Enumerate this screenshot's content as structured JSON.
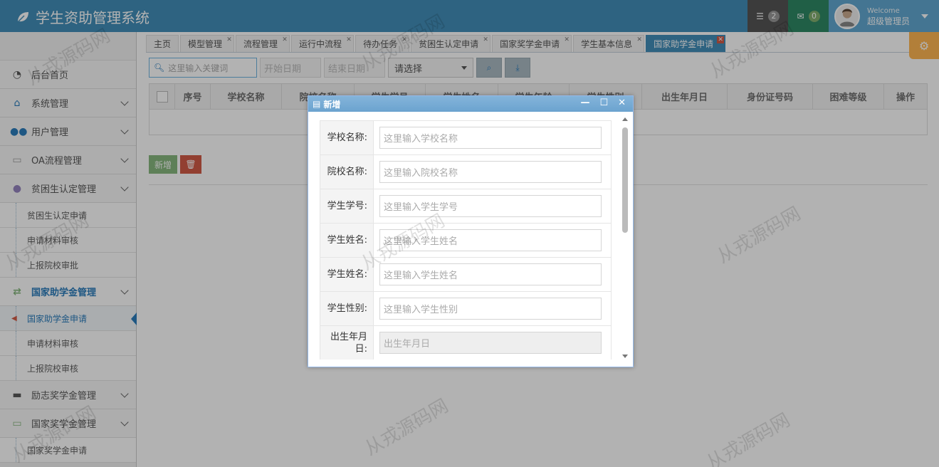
{
  "app": {
    "title": "学生资助管理系统"
  },
  "topbar": {
    "tasks_badge": "2",
    "mail_badge": "0",
    "welcome": "Welcome",
    "username": "超级管理员"
  },
  "sidebar": {
    "items": [
      {
        "label": "后台首页",
        "icon": "dashboard-icon"
      },
      {
        "label": "系统管理",
        "icon": "home-icon"
      },
      {
        "label": "用户管理",
        "icon": "users-icon"
      },
      {
        "label": "OA流程管理",
        "icon": "laptop-icon"
      },
      {
        "label": "贫困生认定管理",
        "icon": "comments-icon"
      }
    ],
    "poor_sub": [
      "贫困生认定申请",
      "申请材料审核",
      "上报院校审批"
    ],
    "grant_label": "国家助学金管理",
    "grant_sub": [
      "国家助学金申请",
      "申请材料审核",
      "上报院校审核"
    ],
    "inspire_label": "励志奖学金管理",
    "national_label": "国家奖学金管理",
    "national_sub": [
      "国家奖学金申请"
    ]
  },
  "tabs": [
    "主页",
    "模型管理",
    "流程管理",
    "运行中流程",
    "待办任务",
    "贫困生认定申请",
    "国家奖学金申请",
    "学生基本信息",
    "国家助学金申请"
  ],
  "toolbar": {
    "search_placeholder": "这里输入关键词",
    "start_date": "开始日期",
    "end_date": "结束日期",
    "select": "请选择"
  },
  "grid": {
    "columns": [
      "序号",
      "学校名称",
      "院校名称",
      "学生学号",
      "学生姓名",
      "学生年龄",
      "学生性别",
      "出生年月日",
      "身份证号码",
      "困难等级",
      "操作"
    ]
  },
  "actions": {
    "add": "新增"
  },
  "dialog": {
    "title": "新增",
    "fields": [
      {
        "label": "学校名称:",
        "placeholder": "这里输入学校名称"
      },
      {
        "label": "院校名称:",
        "placeholder": "这里输入院校名称"
      },
      {
        "label": "学生学号:",
        "placeholder": "这里输入学生学号"
      },
      {
        "label": "学生姓名:",
        "placeholder": "这里输入学生姓名"
      },
      {
        "label": "学生姓名:",
        "placeholder": "这里输入学生姓名"
      },
      {
        "label": "学生性别:",
        "placeholder": "这里输入学生性别"
      },
      {
        "label": "出生年月日:",
        "placeholder": "出生年月日"
      }
    ]
  },
  "watermark": "从戎源码网",
  "colors": {
    "header": "#438eb9",
    "accent": "#2b7dbc",
    "add": "#87b87f",
    "delete": "#d15b47"
  }
}
